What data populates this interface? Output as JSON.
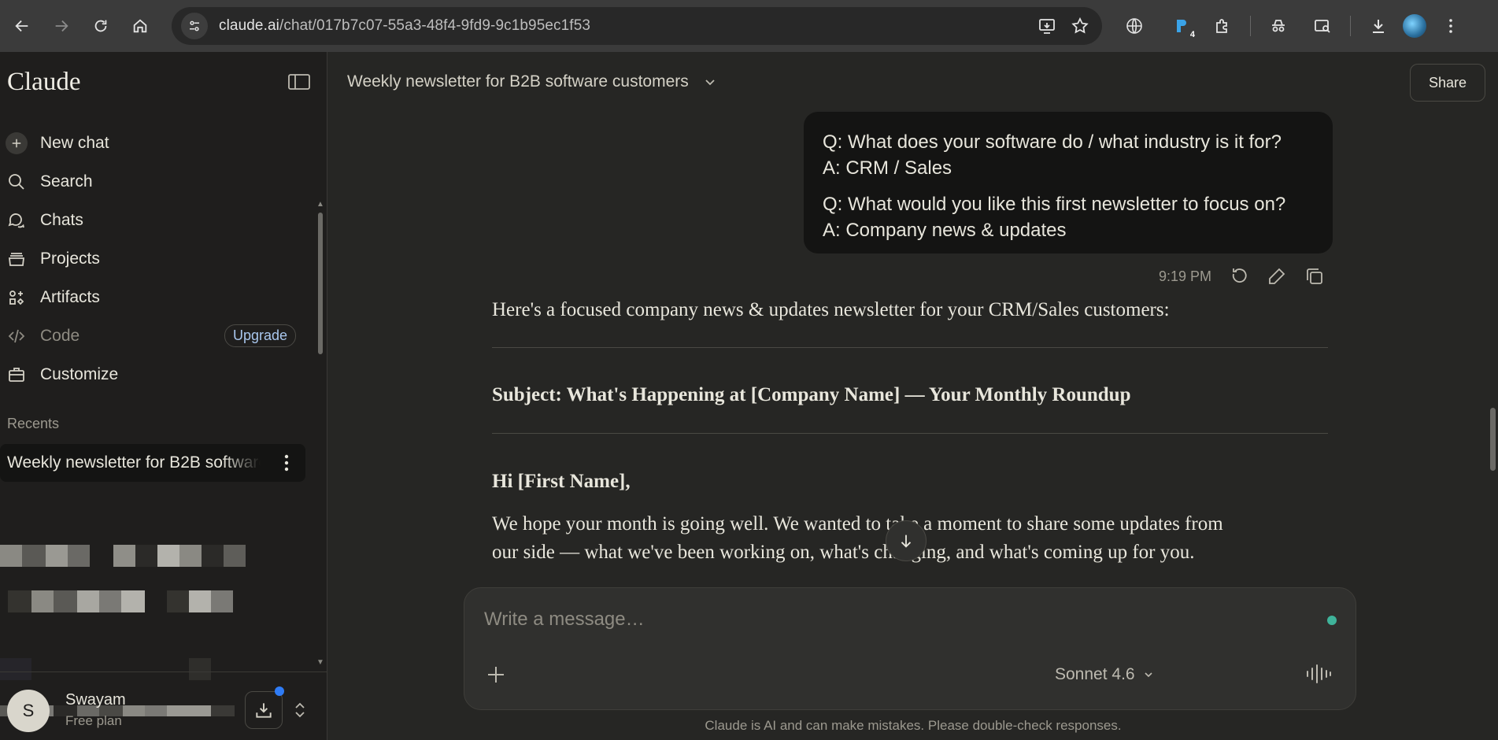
{
  "browser": {
    "url_host": "claude.ai",
    "url_path": "/chat/017b7c07-55a3-48f4-9fd9-9c1b95ec1f53",
    "extension_badge": "4"
  },
  "sidebar": {
    "brand": "Claude",
    "nav": [
      {
        "label": "New chat",
        "icon": "plus-icon"
      },
      {
        "label": "Search",
        "icon": "search-icon"
      },
      {
        "label": "Chats",
        "icon": "chat-bubbles-icon"
      },
      {
        "label": "Projects",
        "icon": "folder-stack-icon"
      },
      {
        "label": "Artifacts",
        "icon": "artifacts-icon"
      },
      {
        "label": "Code",
        "icon": "code-icon",
        "badge": "Upgrade"
      },
      {
        "label": "Customize",
        "icon": "briefcase-icon"
      }
    ],
    "recents_label": "Recents",
    "active_recent": "Weekly newsletter for B2B software customers",
    "user": {
      "initial": "S",
      "name": "Swayam",
      "plan": "Free plan"
    }
  },
  "main": {
    "chat_title": "Weekly newsletter for B2B software customers",
    "share_label": "Share",
    "user_message": {
      "qa": [
        {
          "q": "Q: What does your software do / what industry is it for?",
          "a": "A: CRM / Sales"
        },
        {
          "q": "Q: What would you like this first newsletter to focus on?",
          "a": "A: Company news & updates"
        }
      ],
      "time": "9:19 PM"
    },
    "assistant": {
      "intro": "Here's a focused company news & updates newsletter for your CRM/Sales customers:",
      "subject": "Subject: What's Happening at [Company Name] — Your Monthly Roundup",
      "greeting": "Hi [First Name],",
      "body_line1": "We hope your month is going well. We wanted to take a moment to share some updates from",
      "body_line2": "our side — what we've been working on, what's changing, and what's coming up for you."
    },
    "composer": {
      "placeholder": "Write a message…",
      "model": "Sonnet 4.6"
    },
    "disclaimer": "Claude is AI and can make mistakes. Please double-check responses."
  },
  "colors": {
    "background": "#262624",
    "sidebar": "#1f1e1d",
    "accent_blue": "#a9c7ee",
    "status_green": "#3fb39a",
    "notification_blue": "#2f7cf6"
  }
}
